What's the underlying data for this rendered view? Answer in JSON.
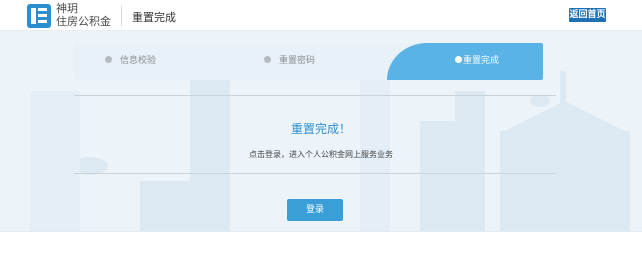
{
  "header": {
    "logo_line1": "神玥",
    "logo_line2": "住房公积金",
    "page_heading": "重置完成",
    "home_button": "返回首页"
  },
  "steps": [
    {
      "label": "信息校验",
      "state": "done"
    },
    {
      "label": "重置密码",
      "state": "done"
    },
    {
      "label": "重置完成",
      "state": "active"
    }
  ],
  "content": {
    "title": "重置完成！",
    "description": "点击登录，进入个人公积金网上服务业务",
    "login_button": "登录"
  },
  "colors": {
    "accent": "#5ab3e6",
    "button": "#3a9fd6",
    "title": "#2e8fd0",
    "home_button": "#1f6fb3",
    "background": "#ecf4fa"
  }
}
